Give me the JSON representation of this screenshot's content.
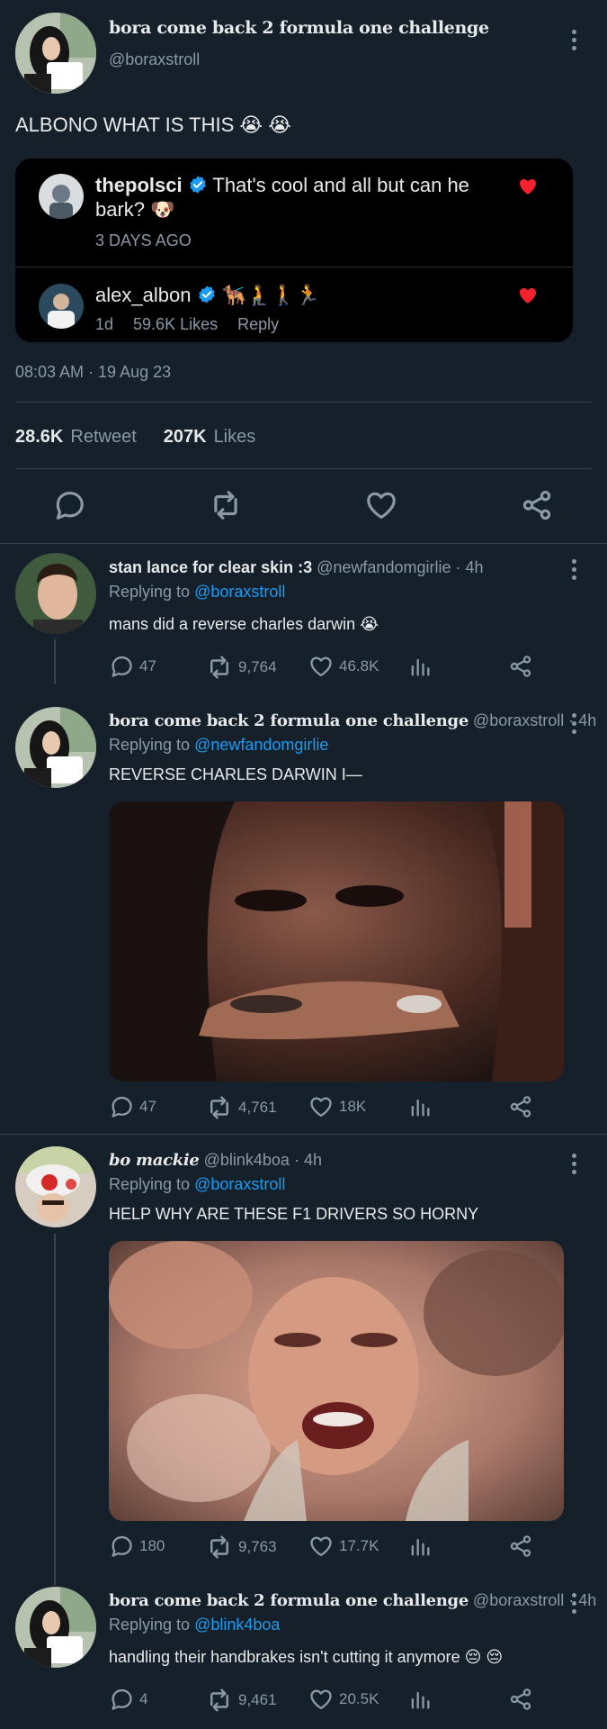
{
  "main_tweet": {
    "display_name": "bora come back 2 formula one challenge",
    "handle": "@boraxstroll",
    "text": "ALBONO WHAT IS THIS 😭 😭",
    "quoted_card": {
      "comment_1": {
        "username": "thepolsci",
        "text": "That's cool and all but can he bark? 🐶",
        "meta": "3 DAYS AGO"
      },
      "comment_2": {
        "username": "alex_albon",
        "text": "🐕‍🦺🧎🚶🏃",
        "time": "1d",
        "likes": "59.6K Likes",
        "reply_label": "Reply"
      }
    },
    "timestamp": "08:03 AM · 19 Aug 23",
    "retweets_count": "28.6K",
    "retweets_label": "Retweet",
    "likes_count": "207K",
    "likes_label": "Likes"
  },
  "replies": [
    {
      "display_name": "stan lance for clear skin :3",
      "handle_time": "@newfandomgirlie · 4h",
      "replying_prefix": "Replying to",
      "replying_to": "@boraxstroll",
      "text": "mans did a reverse charles darwin 😭",
      "replies": "47",
      "retweets": "9,764",
      "likes": "46.8K"
    },
    {
      "display_name": "bora come back 2 formula one challenge",
      "handle_time": "@boraxstroll · 4h",
      "replying_prefix": "Replying to",
      "replying_to": "@newfandomgirlie",
      "text": "REVERSE CHARLES DARWIN I—",
      "replies": "47",
      "retweets": "4,761",
      "likes": "18K"
    },
    {
      "display_name": "bo mackie",
      "handle_time": "@blink4boa · 4h",
      "replying_prefix": "Replying to",
      "replying_to": "@boraxstroll",
      "text": "HELP WHY ARE THESE F1 DRIVERS SO HORNY",
      "replies": "180",
      "retweets": "9,763",
      "likes": "17.7K"
    },
    {
      "display_name": "bora come back 2 formula one challenge",
      "handle_time": "@boraxstroll · 4h",
      "replying_prefix": "Replying to",
      "replying_to": "@blink4boa",
      "text": "handling their handbrakes isn't cutting it anymore 😔 😔",
      "replies": "4",
      "retweets": "9,461",
      "likes": "20.5K"
    }
  ],
  "colors": {
    "background": "#15202b",
    "text": "#e7e9ea",
    "muted": "#8b98a5",
    "link": "#1d9bf0",
    "heart": "#f4212e",
    "quote_card": "#000000"
  }
}
